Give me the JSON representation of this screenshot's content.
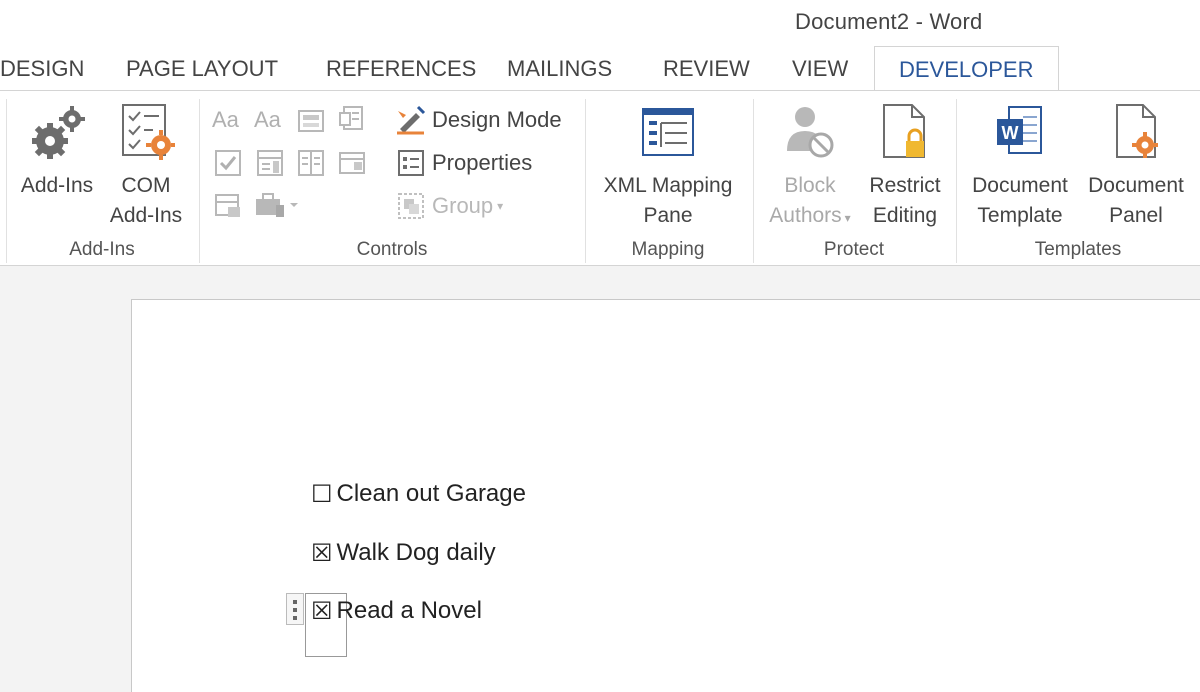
{
  "window": {
    "title": "Document2 - Word"
  },
  "tabs": [
    "DESIGN",
    "PAGE LAYOUT",
    "REFERENCES",
    "MAILINGS",
    "REVIEW",
    "VIEW",
    "DEVELOPER"
  ],
  "active_tab": "DEVELOPER",
  "ribbon": {
    "groups": {
      "addins": "Add-Ins",
      "controls": "Controls",
      "mapping": "Mapping",
      "protect": "Protect",
      "templates": "Templates"
    },
    "buttons": {
      "addins_l1": "Add-Ins",
      "com_l1": "COM",
      "com_l2": "Add-Ins",
      "design_mode": "Design Mode",
      "properties": "Properties",
      "group": "Group",
      "xml_l1": "XML Mapping",
      "xml_l2": "Pane",
      "block_l1": "Block",
      "block_l2": "Authors",
      "restrict_l1": "Restrict",
      "restrict_l2": "Editing",
      "doctemplate_l1": "Document",
      "doctemplate_l2": "Template",
      "docpanel_l1": "Document",
      "docpanel_l2": "Panel"
    },
    "control_glyphs": {
      "rich_text": "Aa",
      "plain_text": "Aa"
    }
  },
  "document": {
    "items": [
      {
        "box": "☐",
        "text": "Clean out Garage",
        "checked": false
      },
      {
        "box": "☒",
        "text": "Walk Dog daily",
        "checked": true
      },
      {
        "box": "☒",
        "text": "Read a Novel",
        "checked": true
      }
    ]
  },
  "colors": {
    "accent": "#2b579a",
    "orange": "#e8833a",
    "gray_icon": "#6d6d6d",
    "word_blue": "#2b579a"
  }
}
